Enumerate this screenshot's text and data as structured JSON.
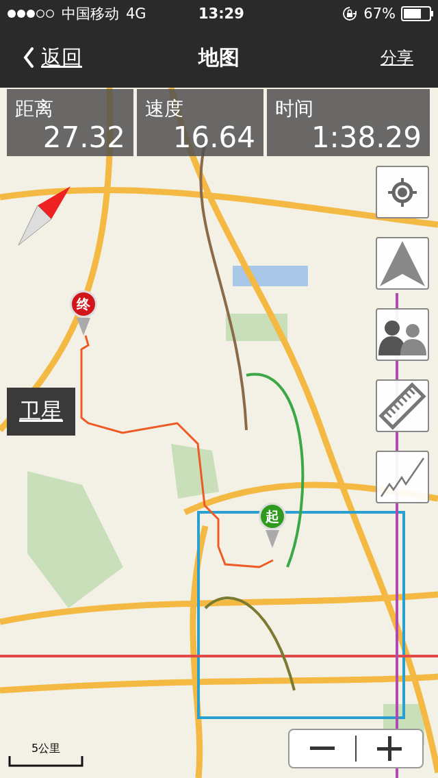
{
  "status_bar": {
    "carrier": "中国移动",
    "network": "4G",
    "time": "13:29",
    "battery": "67%"
  },
  "nav_bar": {
    "back": "返回",
    "title": "地图",
    "action": "分享"
  },
  "stats": [
    {
      "label": "距离",
      "value": "27.32"
    },
    {
      "label": "速度",
      "value": "16.64"
    },
    {
      "label": "时间",
      "value": "1:38.29"
    }
  ],
  "map": {
    "satellite_button": "卫星",
    "scale": "5公里",
    "markers": [
      {
        "kind": "end",
        "label": "终"
      },
      {
        "kind": "start",
        "label": "起"
      }
    ]
  }
}
